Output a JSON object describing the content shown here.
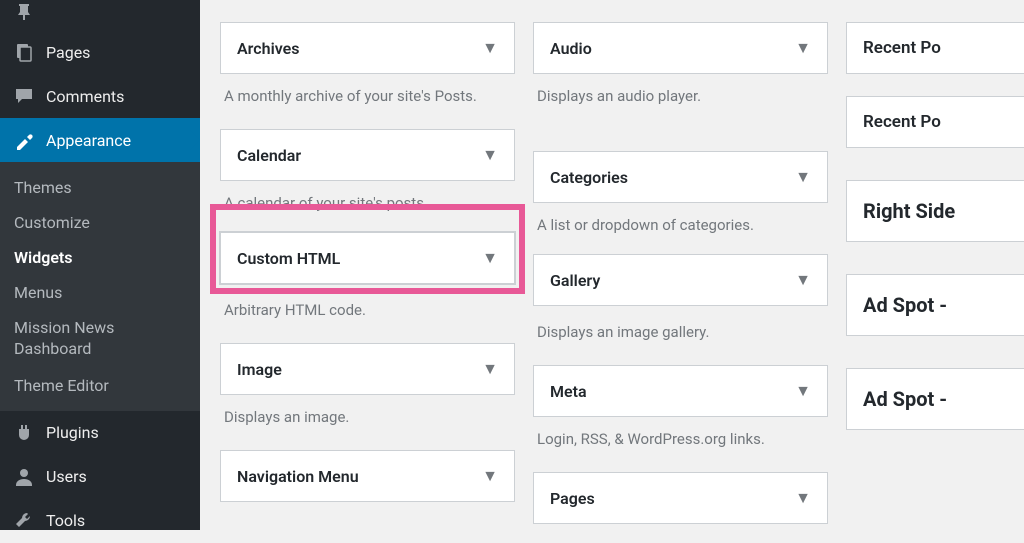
{
  "sidebar": {
    "items": [
      {
        "label": "Pages"
      },
      {
        "label": "Comments"
      },
      {
        "label": "Appearance"
      },
      {
        "label": "Plugins"
      },
      {
        "label": "Users"
      },
      {
        "label": "Tools"
      }
    ],
    "submenu": [
      {
        "label": "Themes"
      },
      {
        "label": "Customize"
      },
      {
        "label": "Widgets"
      },
      {
        "label": "Menus"
      },
      {
        "label": "Mission News Dashboard"
      },
      {
        "label": "Theme Editor"
      }
    ]
  },
  "widgets": {
    "col1": [
      {
        "title": "Archives",
        "desc": "A monthly archive of your site's Posts."
      },
      {
        "title": "Calendar",
        "desc": "A calendar of your site's posts."
      },
      {
        "title": "Custom HTML",
        "desc": "Arbitrary HTML code.",
        "highlight": true
      },
      {
        "title": "Image",
        "desc": "Displays an image."
      },
      {
        "title": "Navigation Menu"
      }
    ],
    "col2": [
      {
        "title": "Audio",
        "desc": "Displays an audio player."
      },
      {
        "title": "Categories",
        "desc": "A list or dropdown of categories."
      },
      {
        "title": "Gallery",
        "desc": "Displays an image gallery."
      },
      {
        "title": "Meta",
        "desc": "Login, RSS, & WordPress.org links."
      },
      {
        "title": "Pages"
      }
    ]
  },
  "right": [
    {
      "label": "Recent Po",
      "head": false
    },
    {
      "label": "Recent Po",
      "head": false
    },
    {
      "label": "Right Side",
      "head": true
    },
    {
      "label": "Ad Spot -",
      "head": true
    },
    {
      "label": "Ad Spot -",
      "head": true
    }
  ]
}
